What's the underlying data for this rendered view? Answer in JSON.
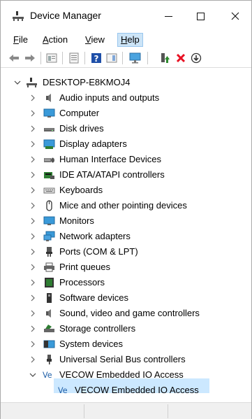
{
  "window": {
    "title": "Device Manager"
  },
  "menu": [
    {
      "label": "File",
      "accel": "F",
      "rest": "ile"
    },
    {
      "label": "Action",
      "accel": "A",
      "rest": "ction"
    },
    {
      "label": "View",
      "accel": "V",
      "rest": "iew"
    },
    {
      "label": "Help",
      "accel": "H",
      "rest": "elp"
    }
  ],
  "toolbar": [
    "back-arrow-icon",
    "forward-arrow-icon",
    "properties-icon",
    "details-pane-icon",
    "help-icon",
    "action-pane-icon",
    "monitor-scan-icon",
    "update-driver-icon",
    "uninstall-icon",
    "disable-icon"
  ],
  "tree": {
    "root": "DESKTOP-E8KMOJ4",
    "categories": [
      "Audio inputs and outputs",
      "Computer",
      "Disk drives",
      "Display adapters",
      "Human Interface Devices",
      "IDE ATA/ATAPI controllers",
      "Keyboards",
      "Mice and other pointing devices",
      "Monitors",
      "Network adapters",
      "Ports (COM & LPT)",
      "Print queues",
      "Processors",
      "Software devices",
      "Sound, video and game controllers",
      "Storage controllers",
      "System devices",
      "Universal Serial Bus controllers",
      "VECOW Embedded IO Access"
    ],
    "expanded_child": "VECOW Embedded IO Access"
  },
  "colors": {
    "selection": "#cce8ff",
    "menu_active": "#cce4f7",
    "uninstall_red": "#e81123",
    "update_green": "#2e8b2e"
  }
}
